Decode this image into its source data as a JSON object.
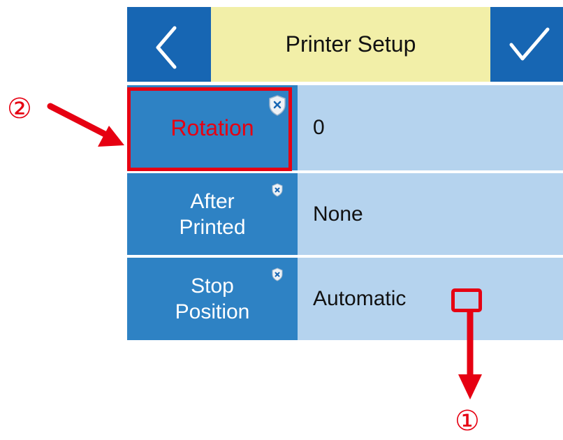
{
  "header": {
    "title": "Printer Setup",
    "back_icon": "chevron-left-icon",
    "confirm_icon": "checkmark-icon"
  },
  "settings": [
    {
      "label": "Rotation",
      "value": "0",
      "highlighted": true
    },
    {
      "label": "After\nPrinted",
      "value": "None"
    },
    {
      "label": "Stop\nPosition",
      "value": "Automatic"
    }
  ],
  "annotations": {
    "callout_1": "①",
    "callout_2": "②"
  },
  "colors": {
    "header_button": "#1766b3",
    "title_bar": "#f2efa8",
    "label_cell": "#2e82c4",
    "value_cell": "#b5d3ee",
    "annotation": "#e60012"
  }
}
